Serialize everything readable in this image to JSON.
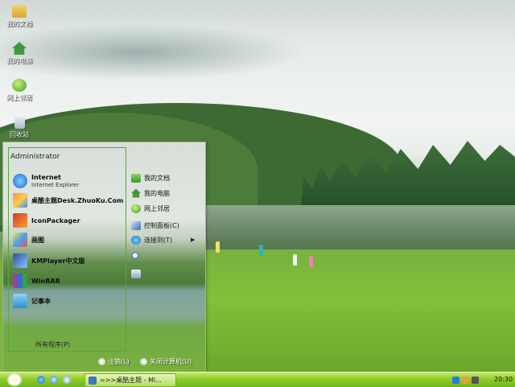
{
  "desktop": {
    "icons": [
      {
        "label": "我的文档",
        "icon": "folder-icon"
      },
      {
        "label": "我的电脑",
        "icon": "computer-home-icon"
      },
      {
        "label": "网上邻居",
        "icon": "network-globe-icon"
      },
      {
        "label": "回收站",
        "icon": "recycle-bin-icon"
      }
    ]
  },
  "start_menu": {
    "user": "Administrator",
    "left_items": [
      {
        "title": "Internet",
        "subtitle": "Internet Explorer",
        "icon": "internet-explorer-icon"
      },
      {
        "title": "桌酷主题Desk.ZhuoKu.Com",
        "subtitle": "",
        "icon": "theme-icon"
      },
      {
        "title": "IconPackager",
        "subtitle": "",
        "icon": "iconpackager-icon"
      },
      {
        "title": "画图",
        "subtitle": "",
        "icon": "paint-icon"
      },
      {
        "title": "KMPlayer中文版",
        "subtitle": "",
        "icon": "kmplayer-icon"
      },
      {
        "title": "WinRAR",
        "subtitle": "",
        "icon": "winrar-icon"
      },
      {
        "title": "记事本",
        "subtitle": "",
        "icon": "notepad-icon"
      }
    ],
    "all_programs": "所有程序(P)",
    "right_items": [
      {
        "label": "我的文档",
        "icon": "folder-icon"
      },
      {
        "label": "我的电脑",
        "icon": "computer-icon"
      },
      {
        "label": "网上邻居",
        "icon": "network-icon"
      },
      {
        "label": "控制面板(C)",
        "icon": "control-panel-icon"
      },
      {
        "label": "连接到(T)",
        "icon": "connect-icon"
      },
      {
        "label": "",
        "icon": "search-icon"
      },
      {
        "label": "",
        "icon": "run-icon"
      }
    ],
    "logoff": "注销(L)",
    "shutdown": "关闭计算机(U)"
  },
  "taskbar": {
    "window_button": "=>>桌酷主题 - Mi...",
    "clock": "20:30"
  }
}
